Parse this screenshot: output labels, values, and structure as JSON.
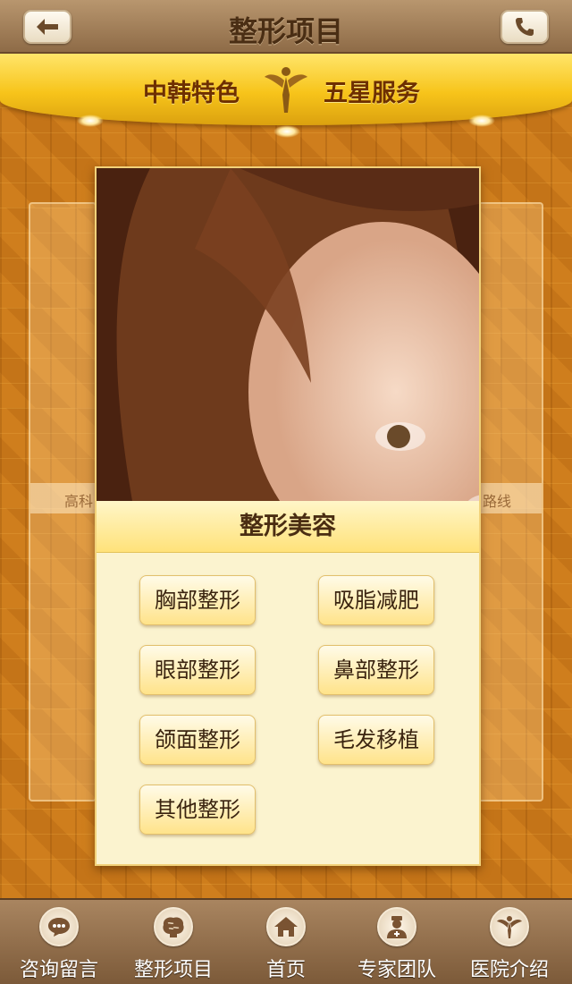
{
  "header": {
    "title": "整形项目"
  },
  "banner": {
    "left": "中韩特色",
    "right": "五星服务"
  },
  "ghost": {
    "left_text": "高科",
    "right_text": "路线"
  },
  "card": {
    "title": "整形美容",
    "items": [
      "胸部整形",
      "吸脂减肥",
      "眼部整形",
      "鼻部整形",
      "颌面整形",
      "毛发移植",
      "其他整形"
    ]
  },
  "tabs": [
    {
      "label": "咨询留言",
      "icon": "chat-bubble-icon"
    },
    {
      "label": "整形项目",
      "icon": "brain-icon"
    },
    {
      "label": "首页",
      "icon": "home-icon"
    },
    {
      "label": "专家团队",
      "icon": "doctor-icon"
    },
    {
      "label": "医院介绍",
      "icon": "angel-logo-icon"
    }
  ],
  "colors": {
    "accent": "#f7c41a",
    "brand_brown": "#8e6b47",
    "text_dark": "#4a2d12"
  }
}
